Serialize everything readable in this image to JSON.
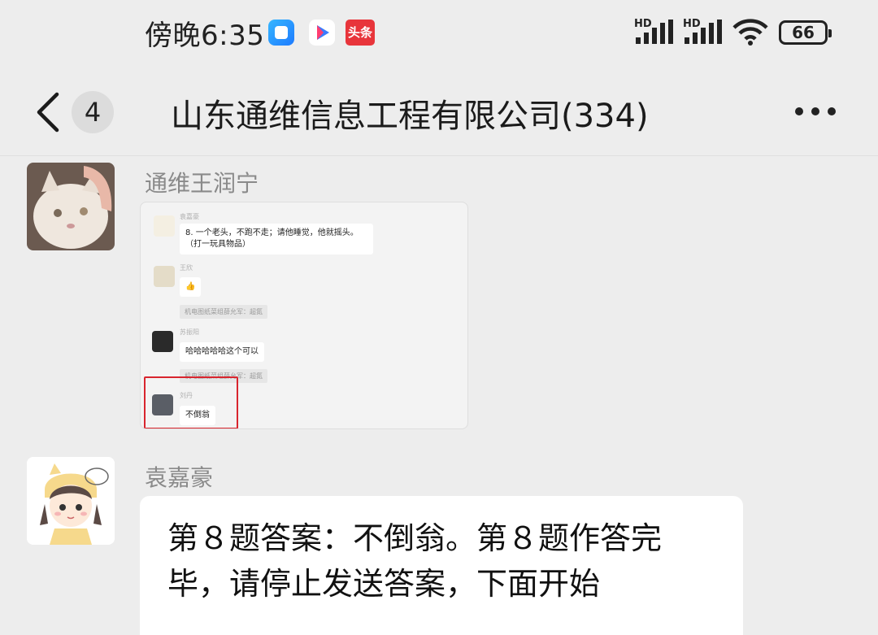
{
  "status_bar": {
    "time": "傍晚6:35",
    "toutiao_label": "头条",
    "signal1_label": "HD",
    "signal2_label": "HD",
    "battery": "66"
  },
  "header": {
    "unread_count": "4",
    "title": "山东通维信息工程有限公司(334)"
  },
  "messages": [
    {
      "sender": "通维王润宁",
      "type": "image",
      "screenshot": {
        "items": [
          {
            "name": "袁嘉豪",
            "text": "8. 一个老头，不跑不走；请他睡觉，他就摇头。（打一玩具物品）"
          },
          {
            "name": "王欣",
            "text": "👍"
          },
          {
            "quote": "机电图纸菜组薛允军：超氮"
          },
          {
            "name": "苏振阳",
            "text": "哈哈哈哈哈这个可以"
          },
          {
            "quote": "机电图纸菜组薛允军：超氮"
          },
          {
            "name": "刘丹",
            "text": "不倒翁"
          }
        ]
      }
    },
    {
      "sender": "袁嘉豪",
      "type": "text",
      "text": "第８题答案：不倒翁。第８题作答完毕，请停止发送答案，下面开始"
    }
  ]
}
